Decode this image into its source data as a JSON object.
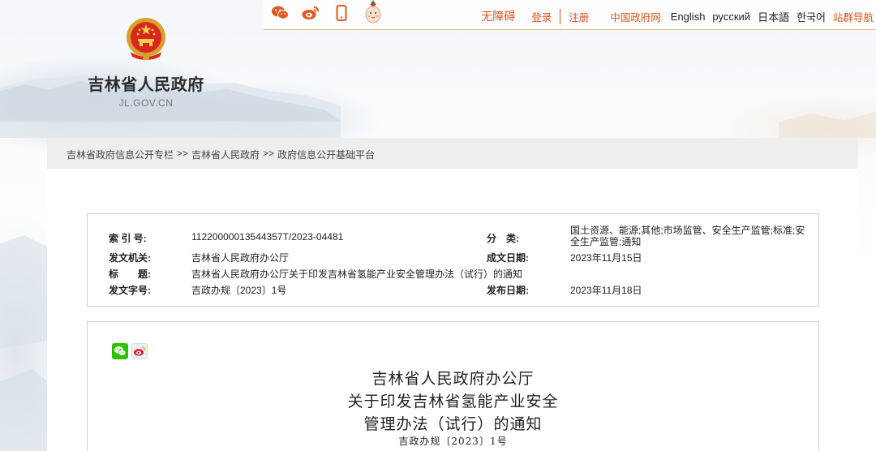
{
  "site": {
    "title": "吉林省人民政府",
    "domain": "JL.GOV.CN"
  },
  "topbar": {
    "social_icons": [
      "wechat-icon",
      "weibo-icon",
      "mobile-icon",
      "mascot-icon"
    ],
    "accessibility": "无障碍",
    "login": "登录",
    "register": "注册",
    "gov_site": "中国政府网",
    "lang_en": "English",
    "lang_ru": "русский",
    "lang_jp": "日本語",
    "lang_kr": "한국어",
    "site_nav": "站群导航"
  },
  "breadcrumb": {
    "items": [
      "吉林省政府信息公开专栏",
      "吉林省人民政府",
      "政府信息公开基础平台"
    ],
    "separator": ">>"
  },
  "meta": {
    "index_label": "索 引 号:",
    "index_value": "11220000013544357T/2023-04481",
    "category_label": "分　类:",
    "category_value": "国土资源、能源;其他;市场监管、安全生产监管;标准;安全生产监管;通知",
    "issuer_label": "发文机关:",
    "issuer_value": "吉林省人民政府办公厅",
    "created_label": "成文日期:",
    "created_value": "2023年11月15日",
    "title_label": "标　　题:",
    "title_value": "吉林省人民政府办公厅关于印发吉林省氢能产业安全管理办法（试行）的通知",
    "docno_label": "发文字号:",
    "docno_value": "吉政办规〔2023〕1号",
    "published_label": "发布日期:",
    "published_value": "2023年11月18日"
  },
  "document": {
    "title_line1": "吉林省人民政府办公厅",
    "title_line2": "关于印发吉林省氢能产业安全",
    "title_line3": "管理办法（试行）的通知",
    "doc_number": "吉政办规〔2023〕1号",
    "share_icons": [
      "wechat-share-icon",
      "weibo-share-icon"
    ]
  },
  "colors": {
    "accent": "#d9541d",
    "topbar_border": "#e7b48a",
    "breadcrumb_bg": "#eeeeee"
  }
}
